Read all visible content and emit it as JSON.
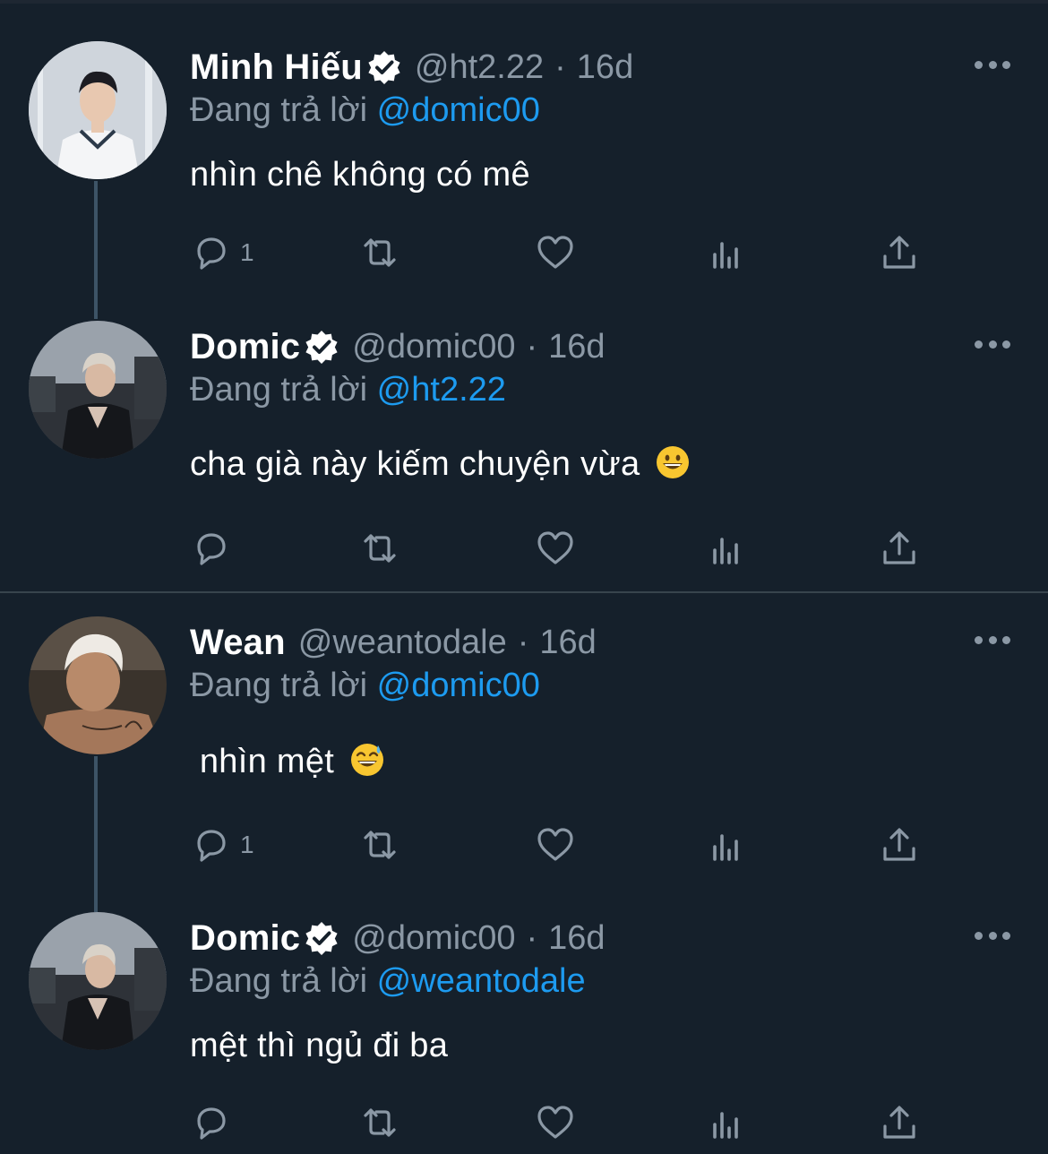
{
  "replying_prefix": "Đang trả lời",
  "icons": {
    "verified": "verified-badge-icon",
    "more": "more-options-icon",
    "reply": "reply-icon",
    "retweet": "retweet-icon",
    "like": "like-icon",
    "views": "views-icon",
    "share": "share-icon"
  },
  "colors": {
    "background": "#15202b",
    "accent": "#1d9bf0",
    "muted": "#8b98a5",
    "divider": "#38444d"
  },
  "tweets": [
    {
      "name": "Minh Hiếu",
      "verified": true,
      "handle": "@ht2.22",
      "time": "16d",
      "replying_to": "@domic00",
      "text": "nhìn chê không có mê",
      "emoji": "",
      "reply_count": "1"
    },
    {
      "name": "Domic",
      "verified": true,
      "handle": "@domic00",
      "time": "16d",
      "replying_to": "@ht2.22",
      "text": "cha già này kiếm chuyện vừa",
      "emoji": "grinning-face",
      "reply_count": ""
    },
    {
      "name": "Wean",
      "verified": false,
      "handle": "@weantodale",
      "time": "16d",
      "replying_to": "@domic00",
      "text": " nhìn mệt",
      "emoji": "grinning-face-with-sweat",
      "reply_count": "1"
    },
    {
      "name": "Domic",
      "verified": true,
      "handle": "@domic00",
      "time": "16d",
      "replying_to": "@weantodale",
      "text": "mệt thì ngủ đi ba",
      "emoji": "",
      "reply_count": ""
    }
  ]
}
